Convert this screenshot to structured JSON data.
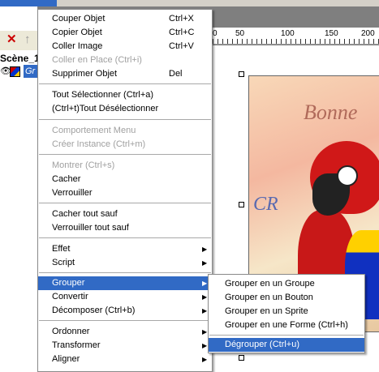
{
  "scene_panel": {
    "scene_label": "Scène_1",
    "layer_label": "Gr"
  },
  "ruler": {
    "labels": [
      "0",
      "50",
      "100",
      "150",
      "200"
    ]
  },
  "artwork": {
    "text_bonne": "Bonne",
    "text_cr": "CR"
  },
  "context_menu": {
    "items": [
      {
        "label": "Couper Objet",
        "shortcut": "Ctrl+X",
        "disabled": false
      },
      {
        "label": "Copier Objet",
        "shortcut": "Ctrl+C",
        "disabled": false
      },
      {
        "label": "Coller Image",
        "shortcut": "Ctrl+V",
        "disabled": false
      },
      {
        "label": "Coller en Place (Ctrl+i)",
        "shortcut": "",
        "disabled": true
      },
      {
        "label": "Supprimer Objet",
        "shortcut": "Del",
        "disabled": false
      },
      {
        "label": "Tout Sélectionner (Ctrl+a)",
        "shortcut": "",
        "disabled": false
      },
      {
        "label": "(Ctrl+t)Tout Désélectionner",
        "shortcut": "",
        "disabled": false
      },
      {
        "label": "Comportement Menu",
        "shortcut": "",
        "disabled": true
      },
      {
        "label": "Créer Instance (Ctrl+m)",
        "shortcut": "",
        "disabled": true
      },
      {
        "label": "Montrer (Ctrl+s)",
        "shortcut": "",
        "disabled": true
      },
      {
        "label": "Cacher",
        "shortcut": "",
        "disabled": false
      },
      {
        "label": "Verrouiller",
        "shortcut": "",
        "disabled": false
      },
      {
        "label": "Cacher tout sauf",
        "shortcut": "",
        "disabled": false
      },
      {
        "label": "Verrouiller tout sauf",
        "shortcut": "",
        "disabled": false
      },
      {
        "label": "Effet",
        "shortcut": "",
        "disabled": false,
        "submenu": true
      },
      {
        "label": "Script",
        "shortcut": "",
        "disabled": false,
        "submenu": true
      },
      {
        "label": "Grouper",
        "shortcut": "",
        "disabled": false,
        "submenu": true,
        "highlighted": true
      },
      {
        "label": "Convertir",
        "shortcut": "",
        "disabled": false,
        "submenu": true
      },
      {
        "label": "Décomposer (Ctrl+b)",
        "shortcut": "",
        "disabled": false,
        "submenu": true
      },
      {
        "label": "Ordonner",
        "shortcut": "",
        "disabled": false,
        "submenu": true
      },
      {
        "label": "Transformer",
        "shortcut": "",
        "disabled": false,
        "submenu": true
      },
      {
        "label": "Aligner",
        "shortcut": "",
        "disabled": false,
        "submenu": true
      }
    ]
  },
  "submenu_grouper": {
    "items": [
      {
        "label": "Grouper en un Groupe"
      },
      {
        "label": "Grouper en un Bouton"
      },
      {
        "label": "Grouper en un Sprite"
      },
      {
        "label": "Grouper en une Forme (Ctrl+h)"
      },
      {
        "label": "Dégrouper (Ctrl+u)",
        "highlighted": true
      }
    ]
  },
  "colors": {
    "highlight": "#316ac5",
    "disabled_text": "#a0a0a0",
    "menu_background": "#ffffff"
  },
  "icons": {
    "submenu_arrow": "arrow-right-icon",
    "delete": "close-icon",
    "up": "arrow-up-icon"
  }
}
